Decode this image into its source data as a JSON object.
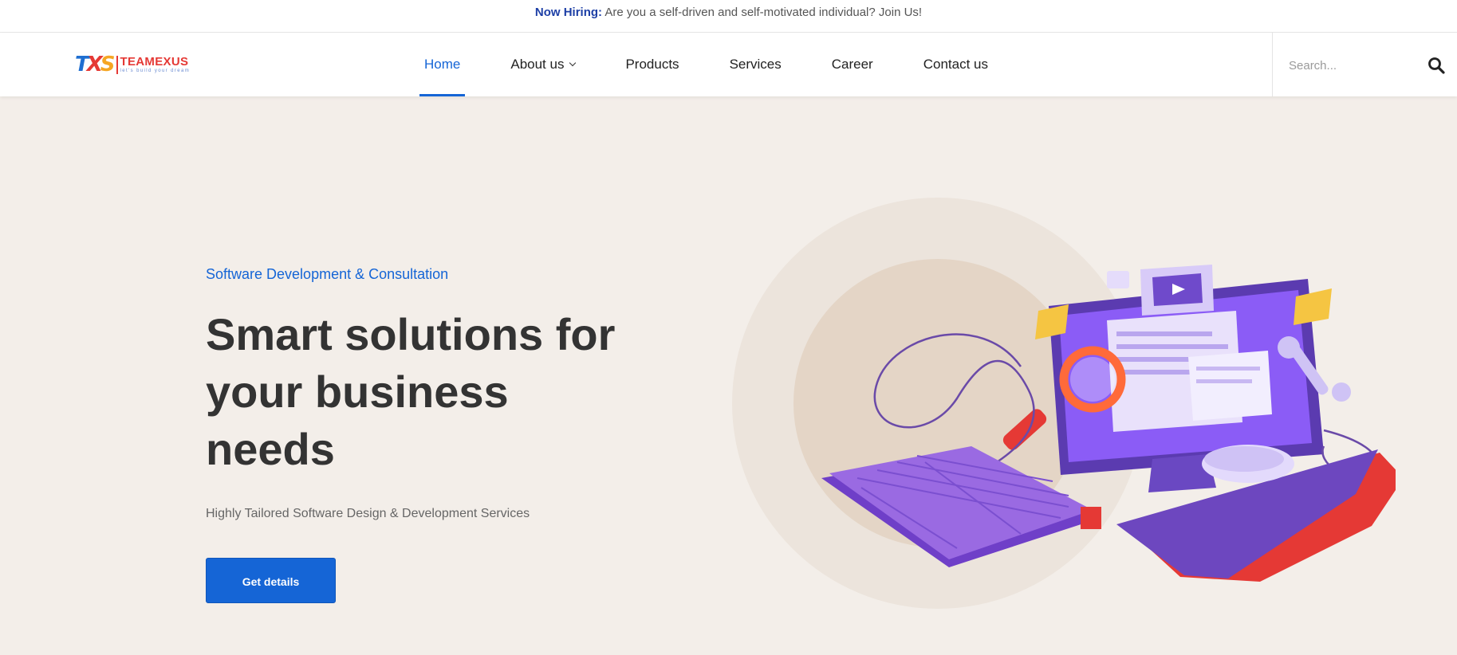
{
  "topbar": {
    "highlight": "Now Hiring:",
    "message": "Are you a self-driven and self-motivated individual? Join Us!"
  },
  "logo": {
    "mark": "TXS",
    "name": "TEAMEXUS",
    "tagline": "let's build your dream"
  },
  "nav": {
    "home": "Home",
    "about": "About us",
    "products": "Products",
    "services": "Services",
    "career": "Career",
    "contact": "Contact us"
  },
  "search": {
    "placeholder": "Search..."
  },
  "hero": {
    "subtitle": "Software Development & Consultation",
    "headline": "Smart solutions for your business needs",
    "description": "Highly Tailored Software Design & Development Services",
    "button": "Get details"
  },
  "colors": {
    "accent": "#1565d6",
    "background": "#f3eee9",
    "illustration_purple": "#7b4fd0"
  },
  "icons": {
    "search": "search-icon",
    "dropdown": "chevron-down-icon",
    "illustration": "computer-workstation-illustration"
  }
}
